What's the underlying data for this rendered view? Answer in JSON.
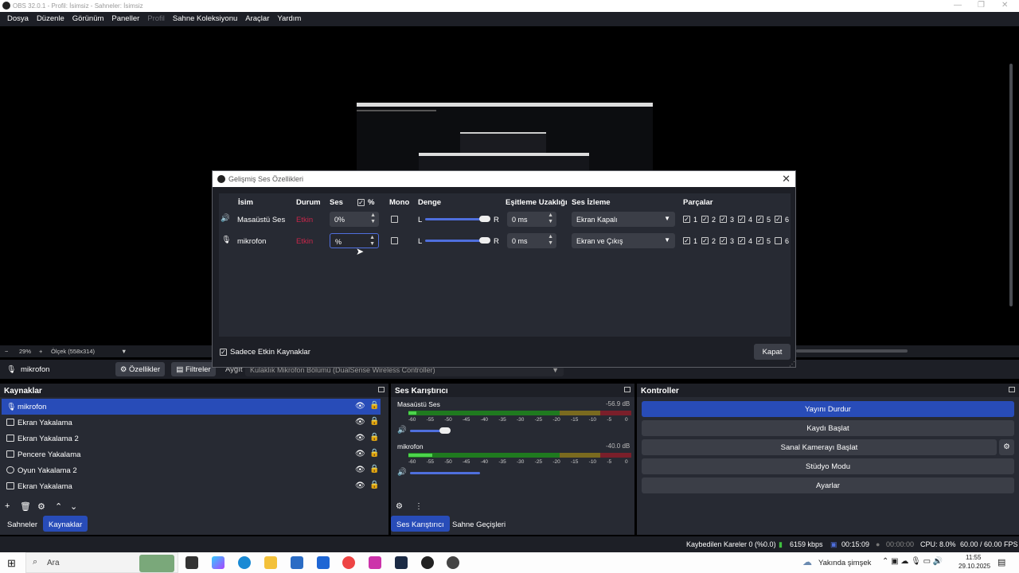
{
  "window": {
    "title": "OBS 32.0.1 - Profil: İsimsiz - Sahneler: İsimsiz",
    "min": "—",
    "max": "❐",
    "close": "✕"
  },
  "menu": [
    "Dosya",
    "Düzenle",
    "Görünüm",
    "Paneller",
    "Profil",
    "Sahne Koleksiyonu",
    "Araçlar",
    "Yardım"
  ],
  "preview_bar": {
    "zoom": "29%",
    "scale": "Ölçek (558x314)"
  },
  "source_bar": {
    "selected": "mikrofon",
    "properties": "Özellikler",
    "filters": "Filtreler",
    "device_label": "Aygıt",
    "device_value": "Kulaklık Mikrofon Bölümü (DualSense Wireless Controller)"
  },
  "sources_dock": {
    "title": "Kaynaklar",
    "items": [
      "mikrofon",
      "Ekran Yakalama",
      "Ekran Yakalama 2",
      "Pencere Yakalama",
      "Oyun Yakalama 2",
      "Ekran Yakalama"
    ],
    "tabs": [
      "Sahneler",
      "Kaynaklar"
    ]
  },
  "mixer_dock": {
    "title": "Ses Karıştırıcı",
    "channels": [
      {
        "name": "Masaüstü Ses",
        "db": "-56.9 dB",
        "volume": 0.62
      },
      {
        "name": "mikrofon",
        "db": "-40.0 dB",
        "volume": 1.0
      }
    ],
    "scale": [
      "-60",
      "-55",
      "-50",
      "-45",
      "-40",
      "-35",
      "-30",
      "-25",
      "-20",
      "-15",
      "-10",
      "-5",
      "0"
    ],
    "tabs": [
      "Ses Karıştırıcı",
      "Sahne Geçişleri"
    ]
  },
  "controls_dock": {
    "title": "Kontroller",
    "buttons": [
      "Yayını Durdur",
      "Kaydı Başlat",
      "Sanal Kamerayı Başlat",
      "Stüdyo Modu",
      "Ayarlar"
    ]
  },
  "status": {
    "dropped": "Kaybedilen Kareler 0 (%0.0)",
    "bitrate": "6159 kbps",
    "stream_time": "00:15:09",
    "rec_time": "00:00:00",
    "cpu": "CPU: 8.0%",
    "fps": "60.00 / 60.00 FPS"
  },
  "taskbar": {
    "search": "Ara",
    "weather": "Yakında şimşek",
    "time": "11:55",
    "date": "29.10.2025"
  },
  "dialog": {
    "title": "Gelişmiş Ses Özellikleri",
    "headers": {
      "name": "İsim",
      "status": "Durum",
      "volume": "Ses",
      "percent": "%",
      "mono": "Mono",
      "balance": "Denge",
      "sync": "Eşitleme Uzaklığı",
      "monitor": "Ses İzleme",
      "tracks": "Parçalar"
    },
    "rows": [
      {
        "name": "Masaüstü Ses",
        "status": "Etkin",
        "volume": "0%",
        "L": "L",
        "R": "R",
        "sync": "0 ms",
        "monitor": "Ekran Kapalı",
        "tracks": [
          "1",
          "2",
          "3",
          "4",
          "5",
          "6"
        ]
      },
      {
        "name": "mikrofon",
        "status": "Etkin",
        "volume": "%",
        "L": "L",
        "R": "R",
        "sync": "0 ms",
        "monitor": "Ekran ve Çıkış",
        "tracks": [
          "1",
          "2",
          "3",
          "4",
          "5",
          "6"
        ]
      }
    ],
    "active_only": "Sadece Etkin Kaynaklar",
    "close": "Kapat"
  }
}
